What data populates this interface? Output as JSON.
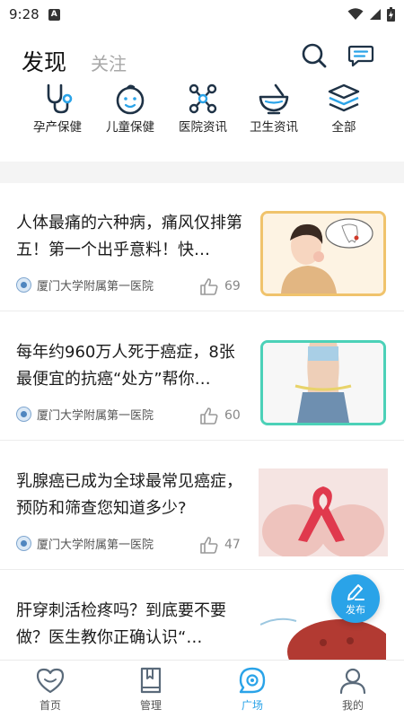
{
  "status": {
    "time": "9:28",
    "notif": "A"
  },
  "header": {
    "tab_discover": "发现",
    "tab_follow": "关注"
  },
  "categories": [
    {
      "label": "孕产保健",
      "icon": "stethoscope-icon"
    },
    {
      "label": "儿童保健",
      "icon": "baby-face-icon"
    },
    {
      "label": "医院资讯",
      "icon": "network-nodes-icon"
    },
    {
      "label": "卫生资讯",
      "icon": "mortar-bowl-icon"
    },
    {
      "label": "全部",
      "icon": "layers-icon"
    }
  ],
  "articles": [
    {
      "title": "人体最痛的六种病，痛风仅排第五！第一个出乎意料！快…",
      "source": "厦门大学附属第一医院",
      "likes": "69"
    },
    {
      "title": "每年约960万人死于癌症，8张最便宜的抗癌“处方”帮你…",
      "source": "厦门大学附属第一医院",
      "likes": "60"
    },
    {
      "title": "乳腺癌已成为全球最常见癌症，预防和筛查您知道多少?",
      "source": "厦门大学附属第一医院",
      "likes": "47"
    },
    {
      "title": "肝穿刺活检疼吗？到底要不要做？医生教你正确认识“…",
      "source": "",
      "likes": ""
    }
  ],
  "fab": {
    "label": "发布"
  },
  "nav": [
    {
      "label": "首页"
    },
    {
      "label": "管理"
    },
    {
      "label": "广场"
    },
    {
      "label": "我的"
    }
  ],
  "colors": {
    "accent": "#2aa3e8",
    "icon_dark": "#1e3246",
    "icon_teal": "#2aa3e8"
  }
}
